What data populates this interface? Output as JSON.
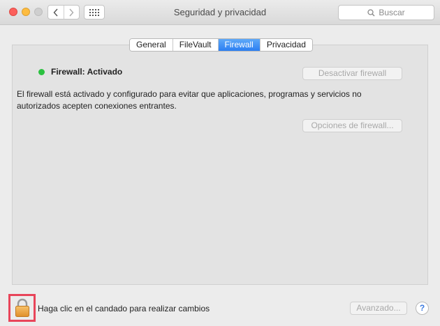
{
  "window": {
    "title": "Seguridad y privacidad",
    "search_placeholder": "Buscar"
  },
  "tabs": [
    {
      "label": "General",
      "active": false
    },
    {
      "label": "FileVault",
      "active": false
    },
    {
      "label": "Firewall",
      "active": true
    },
    {
      "label": "Privacidad",
      "active": false
    }
  ],
  "firewall": {
    "status_label": "Firewall: Activado",
    "status_color": "#2bc140",
    "disable_button": "Desactivar firewall",
    "description": "El firewall está activado y configurado para evitar que aplicaciones, programas y servicios no autorizados acepten conexiones entrantes.",
    "options_button": "Opciones de firewall..."
  },
  "footer": {
    "lock_text": "Haga clic en el candado para realizar cambios",
    "advanced_button": "Avanzado...",
    "help_label": "?"
  },
  "icons": {
    "back": "chevron-left-icon",
    "forward": "chevron-right-icon",
    "grid": "grid-icon",
    "search": "search-icon",
    "lock": "lock-icon"
  },
  "colors": {
    "accent": "#2b7ef2",
    "highlight": "#e8455a"
  }
}
